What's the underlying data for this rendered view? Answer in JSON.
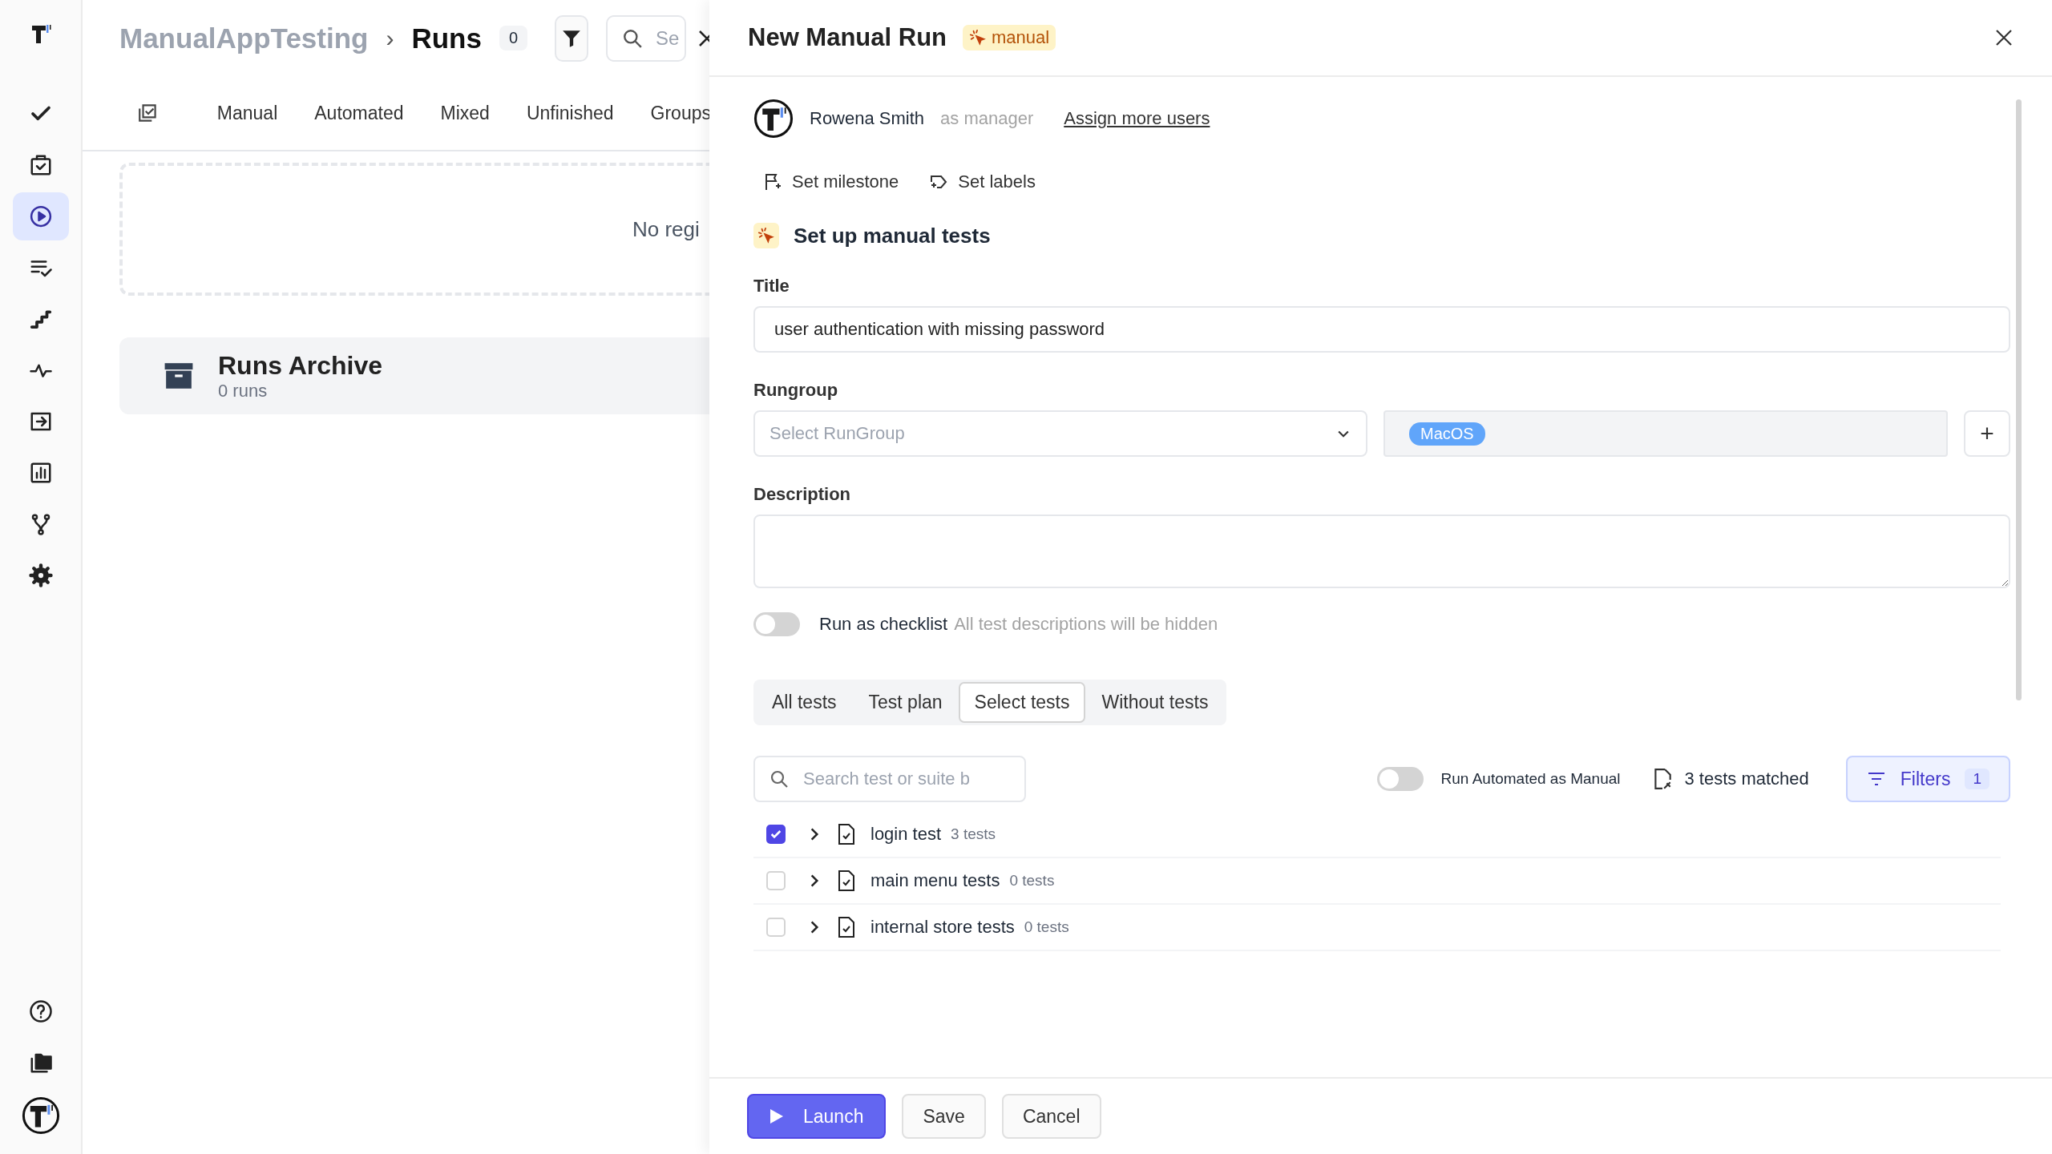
{
  "sidebar": {
    "top": [
      {
        "kind": "check",
        "selected": false
      },
      {
        "kind": "clipboard",
        "selected": false
      },
      {
        "kind": "play",
        "selected": true
      },
      {
        "kind": "list",
        "selected": false
      },
      {
        "kind": "stairs",
        "selected": false
      },
      {
        "kind": "pulse",
        "selected": false
      },
      {
        "kind": "import",
        "selected": false
      },
      {
        "kind": "chart",
        "selected": false
      },
      {
        "kind": "branch",
        "selected": false
      },
      {
        "kind": "gear",
        "selected": false
      }
    ],
    "bottom": [
      {
        "kind": "help",
        "selected": false
      },
      {
        "kind": "folders",
        "selected": false
      }
    ]
  },
  "header": {
    "project": "ManualAppTesting",
    "separator": "›",
    "title": "Runs",
    "count": "0",
    "search_placeholder": "Se"
  },
  "run_tabs": [
    "Manual",
    "Automated",
    "Mixed",
    "Unfinished",
    "Groups"
  ],
  "empty_state": "No regi",
  "archive": {
    "title": "Runs Archive",
    "subtitle": "0 runs"
  },
  "panel": {
    "title": "New Manual Run",
    "badge": "manual",
    "user": {
      "name": "Rowena Smith",
      "role": "as manager",
      "link": "Assign more users"
    },
    "actions": [
      {
        "kind": "milestone",
        "label": "Set milestone"
      },
      {
        "kind": "labels",
        "label": "Set labels"
      }
    ],
    "section": "Set up manual tests",
    "title_field": {
      "label": "Title",
      "value": "user authentication with missing password"
    },
    "rungroup": {
      "label": "Rungroup",
      "placeholder": "Select RunGroup",
      "tags": [
        "MacOS"
      ],
      "add": "+"
    },
    "description": {
      "label": "Description"
    },
    "checklist": {
      "on": false,
      "label": "Run as checklist",
      "hint": "All test descriptions will be hidden"
    },
    "modes": [
      {
        "label": "All tests",
        "selected": false
      },
      {
        "label": "Test plan",
        "selected": false
      },
      {
        "label": "Select tests",
        "selected": true
      },
      {
        "label": "Without tests",
        "selected": false
      }
    ],
    "search_placeholder": "Search test or suite b",
    "automated": {
      "on": false,
      "label": "Run Automated as Manual"
    },
    "matched": "3 tests matched",
    "filters": {
      "label": "Filters",
      "count": "1"
    },
    "suites": [
      {
        "name": "login test",
        "count": "3 tests",
        "checked": true,
        "expanded": false
      },
      {
        "name": "main menu tests",
        "count": "0 tests",
        "checked": false,
        "expanded": false
      },
      {
        "name": "internal store tests",
        "count": "0 tests",
        "checked": false,
        "expanded": false
      }
    ],
    "buttons": [
      {
        "kind": "primary",
        "label": "Launch"
      },
      {
        "kind": "default",
        "label": "Save"
      },
      {
        "kind": "default",
        "label": "Cancel"
      }
    ]
  }
}
